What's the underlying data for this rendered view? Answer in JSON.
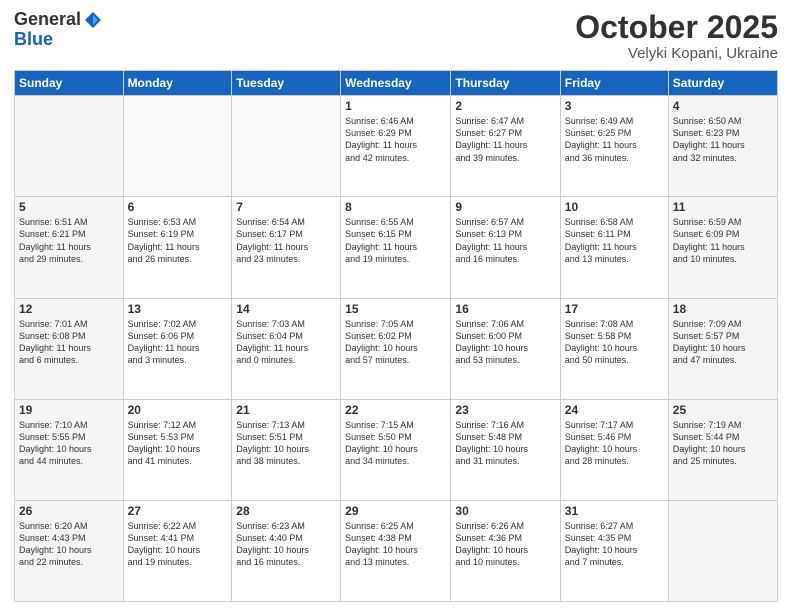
{
  "header": {
    "logo_general": "General",
    "logo_blue": "Blue",
    "month": "October 2025",
    "location": "Velyki Kopani, Ukraine"
  },
  "days_of_week": [
    "Sunday",
    "Monday",
    "Tuesday",
    "Wednesday",
    "Thursday",
    "Friday",
    "Saturday"
  ],
  "weeks": [
    [
      {
        "day": "",
        "info": ""
      },
      {
        "day": "",
        "info": ""
      },
      {
        "day": "",
        "info": ""
      },
      {
        "day": "1",
        "info": "Sunrise: 6:46 AM\nSunset: 6:29 PM\nDaylight: 11 hours\nand 42 minutes."
      },
      {
        "day": "2",
        "info": "Sunrise: 6:47 AM\nSunset: 6:27 PM\nDaylight: 11 hours\nand 39 minutes."
      },
      {
        "day": "3",
        "info": "Sunrise: 6:49 AM\nSunset: 6:25 PM\nDaylight: 11 hours\nand 36 minutes."
      },
      {
        "day": "4",
        "info": "Sunrise: 6:50 AM\nSunset: 6:23 PM\nDaylight: 11 hours\nand 32 minutes."
      }
    ],
    [
      {
        "day": "5",
        "info": "Sunrise: 6:51 AM\nSunset: 6:21 PM\nDaylight: 11 hours\nand 29 minutes."
      },
      {
        "day": "6",
        "info": "Sunrise: 6:53 AM\nSunset: 6:19 PM\nDaylight: 11 hours\nand 26 minutes."
      },
      {
        "day": "7",
        "info": "Sunrise: 6:54 AM\nSunset: 6:17 PM\nDaylight: 11 hours\nand 23 minutes."
      },
      {
        "day": "8",
        "info": "Sunrise: 6:55 AM\nSunset: 6:15 PM\nDaylight: 11 hours\nand 19 minutes."
      },
      {
        "day": "9",
        "info": "Sunrise: 6:57 AM\nSunset: 6:13 PM\nDaylight: 11 hours\nand 16 minutes."
      },
      {
        "day": "10",
        "info": "Sunrise: 6:58 AM\nSunset: 6:11 PM\nDaylight: 11 hours\nand 13 minutes."
      },
      {
        "day": "11",
        "info": "Sunrise: 6:59 AM\nSunset: 6:09 PM\nDaylight: 11 hours\nand 10 minutes."
      }
    ],
    [
      {
        "day": "12",
        "info": "Sunrise: 7:01 AM\nSunset: 6:08 PM\nDaylight: 11 hours\nand 6 minutes."
      },
      {
        "day": "13",
        "info": "Sunrise: 7:02 AM\nSunset: 6:06 PM\nDaylight: 11 hours\nand 3 minutes."
      },
      {
        "day": "14",
        "info": "Sunrise: 7:03 AM\nSunset: 6:04 PM\nDaylight: 11 hours\nand 0 minutes."
      },
      {
        "day": "15",
        "info": "Sunrise: 7:05 AM\nSunset: 6:02 PM\nDaylight: 10 hours\nand 57 minutes."
      },
      {
        "day": "16",
        "info": "Sunrise: 7:06 AM\nSunset: 6:00 PM\nDaylight: 10 hours\nand 53 minutes."
      },
      {
        "day": "17",
        "info": "Sunrise: 7:08 AM\nSunset: 5:58 PM\nDaylight: 10 hours\nand 50 minutes."
      },
      {
        "day": "18",
        "info": "Sunrise: 7:09 AM\nSunset: 5:57 PM\nDaylight: 10 hours\nand 47 minutes."
      }
    ],
    [
      {
        "day": "19",
        "info": "Sunrise: 7:10 AM\nSunset: 5:55 PM\nDaylight: 10 hours\nand 44 minutes."
      },
      {
        "day": "20",
        "info": "Sunrise: 7:12 AM\nSunset: 5:53 PM\nDaylight: 10 hours\nand 41 minutes."
      },
      {
        "day": "21",
        "info": "Sunrise: 7:13 AM\nSunset: 5:51 PM\nDaylight: 10 hours\nand 38 minutes."
      },
      {
        "day": "22",
        "info": "Sunrise: 7:15 AM\nSunset: 5:50 PM\nDaylight: 10 hours\nand 34 minutes."
      },
      {
        "day": "23",
        "info": "Sunrise: 7:16 AM\nSunset: 5:48 PM\nDaylight: 10 hours\nand 31 minutes."
      },
      {
        "day": "24",
        "info": "Sunrise: 7:17 AM\nSunset: 5:46 PM\nDaylight: 10 hours\nand 28 minutes."
      },
      {
        "day": "25",
        "info": "Sunrise: 7:19 AM\nSunset: 5:44 PM\nDaylight: 10 hours\nand 25 minutes."
      }
    ],
    [
      {
        "day": "26",
        "info": "Sunrise: 6:20 AM\nSunset: 4:43 PM\nDaylight: 10 hours\nand 22 minutes."
      },
      {
        "day": "27",
        "info": "Sunrise: 6:22 AM\nSunset: 4:41 PM\nDaylight: 10 hours\nand 19 minutes."
      },
      {
        "day": "28",
        "info": "Sunrise: 6:23 AM\nSunset: 4:40 PM\nDaylight: 10 hours\nand 16 minutes."
      },
      {
        "day": "29",
        "info": "Sunrise: 6:25 AM\nSunset: 4:38 PM\nDaylight: 10 hours\nand 13 minutes."
      },
      {
        "day": "30",
        "info": "Sunrise: 6:26 AM\nSunset: 4:36 PM\nDaylight: 10 hours\nand 10 minutes."
      },
      {
        "day": "31",
        "info": "Sunrise: 6:27 AM\nSunset: 4:35 PM\nDaylight: 10 hours\nand 7 minutes."
      },
      {
        "day": "",
        "info": ""
      }
    ]
  ]
}
